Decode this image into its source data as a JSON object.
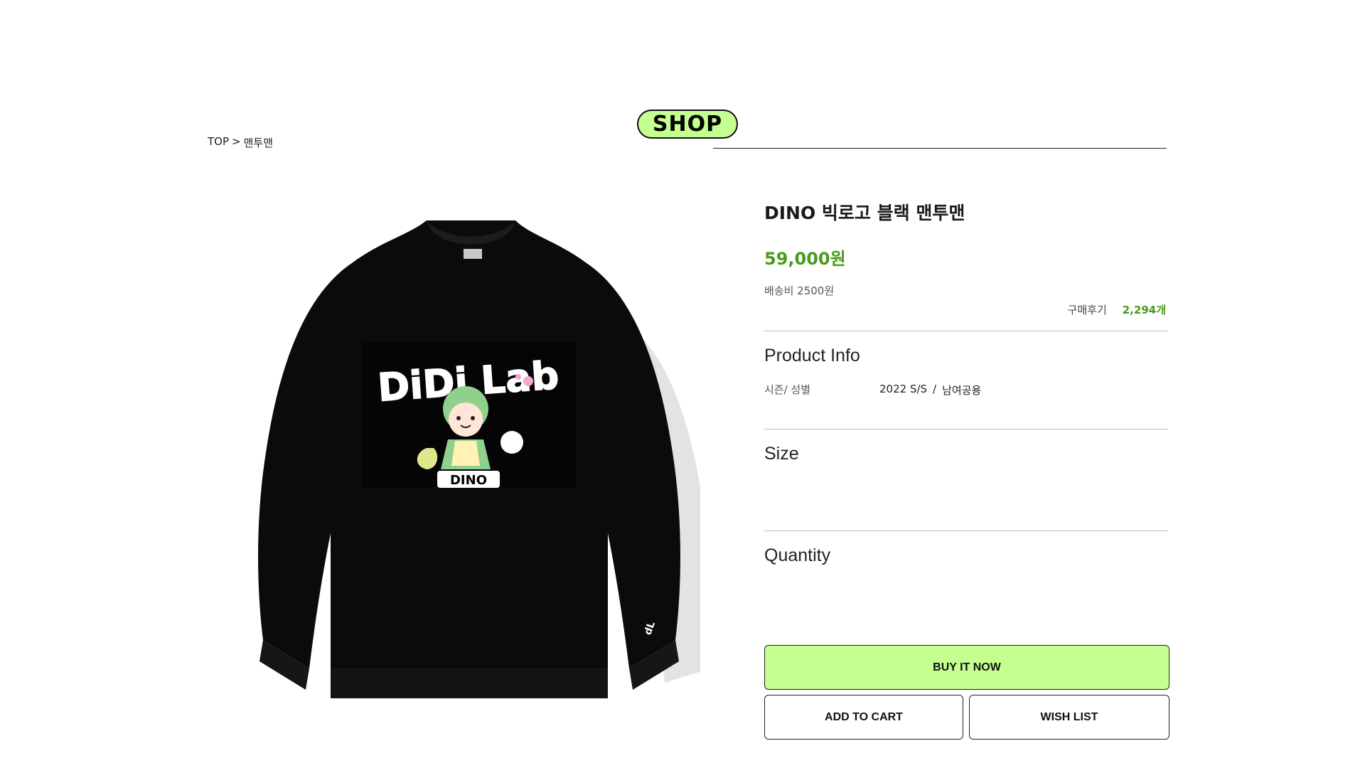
{
  "header": {
    "shop_label": "SHOP"
  },
  "breadcrumb": {
    "home": "TOP",
    "separator": ">",
    "category": "맨투맨"
  },
  "product": {
    "title": "DINO 빅로고 블랙 맨투맨",
    "price": "59,000원",
    "shipping": "배송비 2500원",
    "reviews_label": "구매후기",
    "reviews_count": "2,294개",
    "image_print": {
      "headline": "DiDi Lab",
      "badge": "DINO",
      "sleeve_mark": "dL"
    }
  },
  "sections": {
    "product_info": {
      "title": "Product Info",
      "spec_label": "시즌/ 성별",
      "season": "2022 S/S",
      "separator": "/",
      "gender": "남여공용"
    },
    "size": {
      "title": "Size"
    },
    "quantity": {
      "title": "Quantity"
    }
  },
  "actions": {
    "buy_now": "BUY IT NOW",
    "add_to_cart": "ADD TO CART",
    "wish_list": "WISH LIST"
  },
  "colors": {
    "accent_green": "#c4ff8f",
    "price_green": "#4a9a1c"
  }
}
